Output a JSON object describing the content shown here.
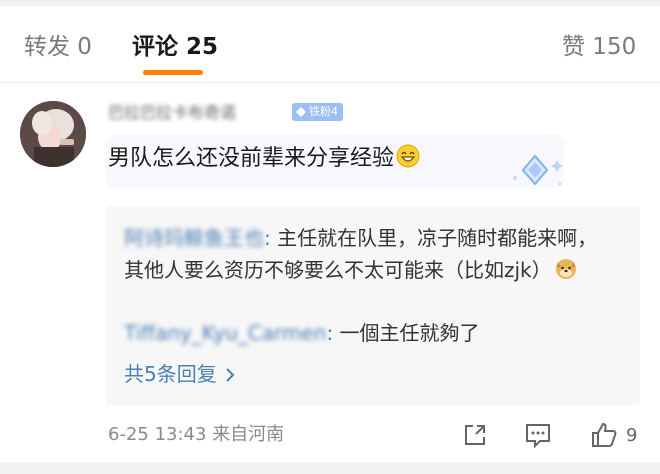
{
  "tabs": {
    "repost": "转发 0",
    "comments": "评论 25",
    "likes": "赞 150"
  },
  "comment": {
    "username": "巴拉巴拉卡布奇诺",
    "badge": "铁粉4",
    "text": "男队怎么还没前辈来分享经验"
  },
  "replies": [
    {
      "author": "阿诗玛鲸鱼王也",
      "separator": ": ",
      "text": "主任就在队里，凉子随时都能来啊，其他人要么资历不够要么不太可能来（比如zjk）"
    },
    {
      "author": "Tiffany_Kyu_Carmen",
      "separator": ": ",
      "text": "一個主任就夠了"
    }
  ],
  "more_replies": "共5条回复",
  "meta": {
    "date": "6-25 13:43",
    "location": "来自河南"
  },
  "actions": {
    "like_count": "9"
  },
  "colors": {
    "accent": "#ff8200",
    "link": "#4a7fb5",
    "badge": "#9bbff5"
  },
  "icons": [
    "share-icon",
    "comment-icon",
    "like-icon",
    "chevron-right-icon",
    "grin-emoji-icon",
    "doge-emoji-icon",
    "sparkle-icon",
    "diamond-icon"
  ]
}
